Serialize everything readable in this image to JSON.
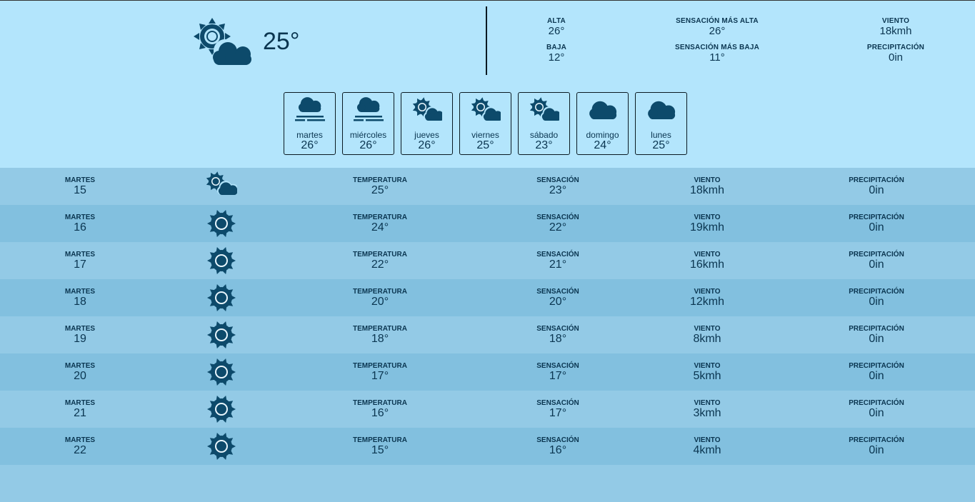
{
  "current": {
    "icon": "sun-cloud-icon",
    "temperature": "25°"
  },
  "stats": {
    "high_label": "ALTA",
    "high_value": "26°",
    "low_label": "BAJA",
    "low_value": "12°",
    "feels_high_label": "SENSACIÓN MÁS ALTA",
    "feels_high_value": "26°",
    "feels_low_label": "SENSACIÓN MÁS BAJA",
    "feels_low_value": "11°",
    "wind_label": "VIENTO",
    "wind_value": "18kmh",
    "precip_label": "PRECIPITACIÓN",
    "precip_value": "0in"
  },
  "forecast": [
    {
      "icon": "fog-cloud-icon",
      "day": "martes",
      "temp": "26°"
    },
    {
      "icon": "fog-cloud-icon",
      "day": "miércoles",
      "temp": "26°"
    },
    {
      "icon": "sun-cloud-icon",
      "day": "jueves",
      "temp": "26°"
    },
    {
      "icon": "sun-cloud-icon",
      "day": "viernes",
      "temp": "25°"
    },
    {
      "icon": "sun-cloud-icon",
      "day": "sábado",
      "temp": "23°"
    },
    {
      "icon": "cloud-icon",
      "day": "domingo",
      "temp": "24°"
    },
    {
      "icon": "cloud-icon",
      "day": "lunes",
      "temp": "25°"
    }
  ],
  "hourly_labels": {
    "temperature": "TEMPERATURA",
    "feels": "SENSACIÓN",
    "wind": "VIENTO",
    "precip": "PRECIPITACIÓN"
  },
  "hourly": [
    {
      "day": "MARTES",
      "num": "15",
      "icon": "sun-cloud-icon",
      "temp": "25°",
      "feels": "23°",
      "wind": "18kmh",
      "precip": "0in"
    },
    {
      "day": "MARTES",
      "num": "16",
      "icon": "sun-icon",
      "temp": "24°",
      "feels": "22°",
      "wind": "19kmh",
      "precip": "0in"
    },
    {
      "day": "MARTES",
      "num": "17",
      "icon": "sun-icon",
      "temp": "22°",
      "feels": "21°",
      "wind": "16kmh",
      "precip": "0in"
    },
    {
      "day": "MARTES",
      "num": "18",
      "icon": "sun-icon",
      "temp": "20°",
      "feels": "20°",
      "wind": "12kmh",
      "precip": "0in"
    },
    {
      "day": "MARTES",
      "num": "19",
      "icon": "sun-icon",
      "temp": "18°",
      "feels": "18°",
      "wind": "8kmh",
      "precip": "0in"
    },
    {
      "day": "MARTES",
      "num": "20",
      "icon": "sun-icon",
      "temp": "17°",
      "feels": "17°",
      "wind": "5kmh",
      "precip": "0in"
    },
    {
      "day": "MARTES",
      "num": "21",
      "icon": "sun-icon",
      "temp": "16°",
      "feels": "17°",
      "wind": "3kmh",
      "precip": "0in"
    },
    {
      "day": "MARTES",
      "num": "22",
      "icon": "sun-icon",
      "temp": "15°",
      "feels": "16°",
      "wind": "4kmh",
      "precip": "0in"
    }
  ],
  "colors": {
    "background": "#b3e5fc",
    "icon": "#0d4a6b",
    "row_odd": "#93cae6",
    "row_even": "#82c0df"
  }
}
